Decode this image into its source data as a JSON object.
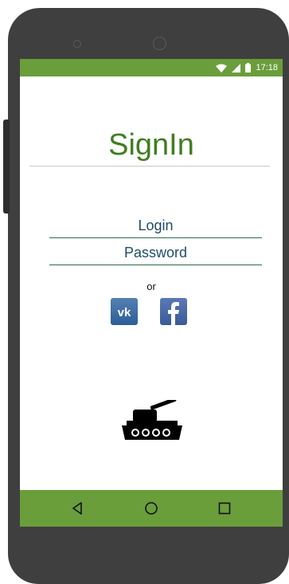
{
  "status_bar": {
    "time": "17:18",
    "icons": [
      "wifi-icon",
      "signal-icon",
      "battery-icon"
    ]
  },
  "title": "SignIn",
  "form": {
    "login_placeholder": "Login",
    "password_placeholder": "Password"
  },
  "or_text": "or",
  "social": [
    {
      "name": "vk",
      "icon": "vk-icon"
    },
    {
      "name": "facebook",
      "icon": "facebook-icon"
    }
  ],
  "logo_icon": "tank-icon",
  "nav_bar": {
    "buttons": [
      "back-icon",
      "home-icon",
      "recent-apps-icon"
    ]
  },
  "colors": {
    "accent": "#6a9e3b",
    "title": "#3f7d22",
    "field_text": "#1f4b6b",
    "field_line": "#2f6b4e"
  }
}
